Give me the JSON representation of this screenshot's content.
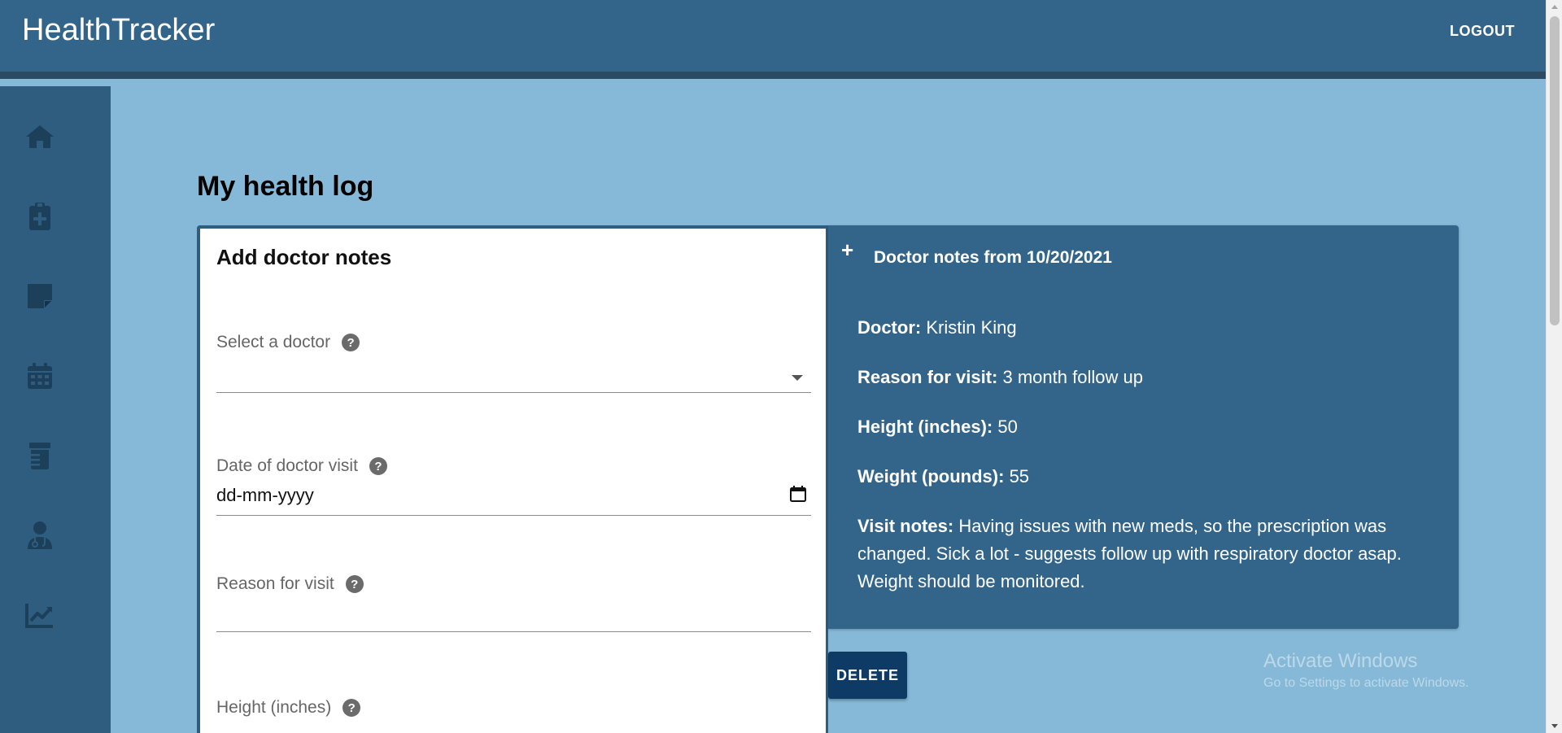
{
  "header": {
    "brand": "HealthTracker",
    "logout_label": "LOGOUT"
  },
  "sidebar": {
    "items": [
      {
        "icon": "home-icon"
      },
      {
        "icon": "clipboard-plus-icon"
      },
      {
        "icon": "sticky-note-icon"
      },
      {
        "icon": "calendar-icon"
      },
      {
        "icon": "prescription-bottle-icon"
      },
      {
        "icon": "doctor-icon"
      },
      {
        "icon": "chart-line-icon"
      }
    ]
  },
  "main": {
    "page_title": "My health log",
    "form": {
      "title": "Add doctor notes",
      "fields": {
        "doctor": {
          "label": "Select a doctor",
          "value": ""
        },
        "visit_date": {
          "label": "Date of doctor visit",
          "value": "dd-mm-yyyy"
        },
        "reason": {
          "label": "Reason for visit",
          "value": ""
        },
        "height": {
          "label": "Height (inches)",
          "value": ""
        }
      }
    },
    "notes_panel": {
      "heading": "Doctor notes from 10/20/2021",
      "doctor_label": "Doctor:",
      "doctor_value": "Kristin King",
      "reason_label": "Reason for visit:",
      "reason_value": "3 month follow up",
      "height_label": "Height (inches):",
      "height_value": "50",
      "weight_label": "Weight (pounds):",
      "weight_value": "55",
      "notes_label": "Visit notes:",
      "notes_value": "Having issues with new meds, so the prescription was changed. Sick a lot - suggests follow up with respiratory doctor asap. Weight should be monitored."
    },
    "delete_label": "DELETE"
  },
  "watermark": {
    "title": "Activate Windows",
    "subtitle": "Go to Settings to activate Windows."
  },
  "colors": {
    "header_bg": "#33658a",
    "page_bg": "#85b9d7",
    "sidebar_bg": "#2f5d80",
    "button_bg": "#0d3b66"
  }
}
